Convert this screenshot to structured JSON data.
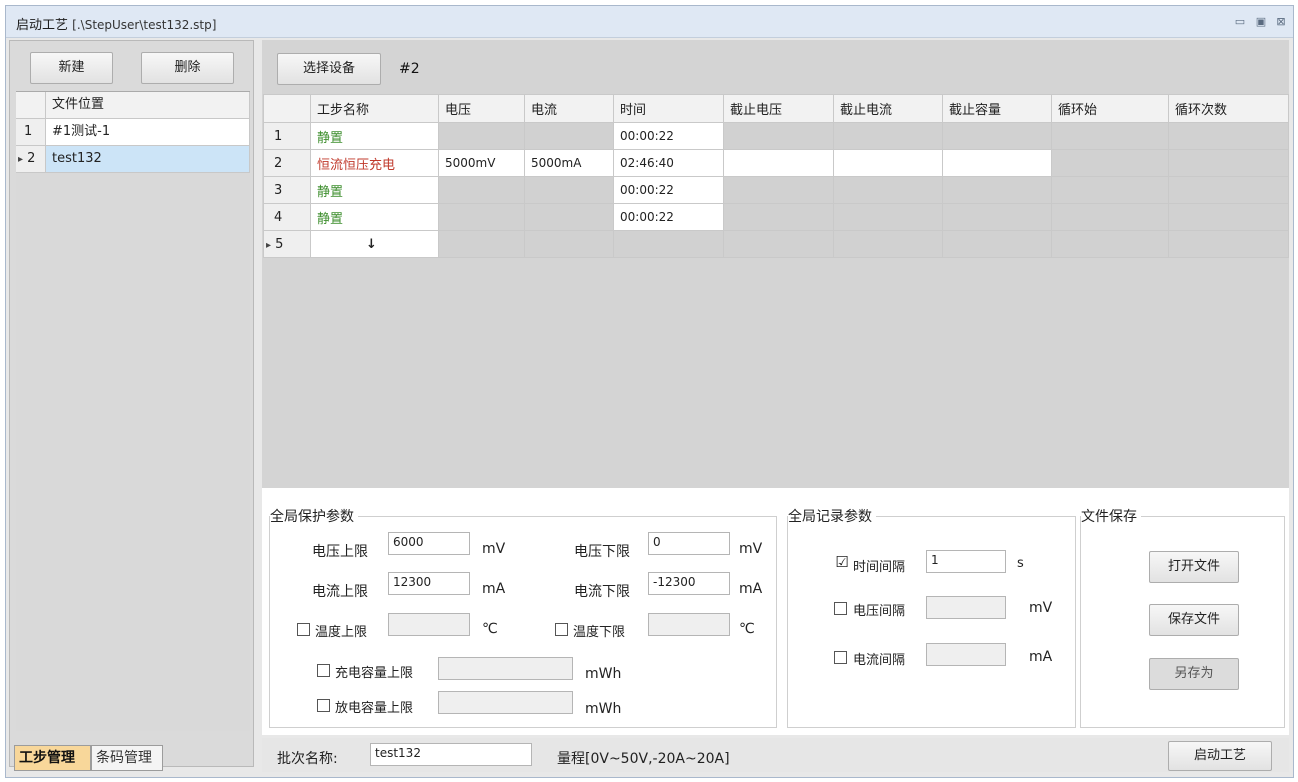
{
  "window": {
    "title": "启动工艺",
    "path": "[.\\StepUser\\test132.stp]",
    "controls": [
      "minimize-icon",
      "maximize-icon",
      "close-icon"
    ]
  },
  "left": {
    "new_label": "新建",
    "delete_label": "删除",
    "column": "文件位置",
    "rows": [
      {
        "index": "1",
        "name": "#1测试-1"
      },
      {
        "index": "2",
        "name": "test132"
      }
    ],
    "selected_marker": "▸"
  },
  "tabs": [
    "工步管理",
    "条码管理"
  ],
  "toolbar": {
    "select_device_label": "选择设备",
    "device_value": "#2"
  },
  "grid": {
    "headers": [
      "工步名称",
      "电压",
      "电流",
      "时间",
      "截止电压",
      "截止电流",
      "截止容量",
      "循环始",
      "循环次数"
    ],
    "rows": [
      {
        "index": "1",
        "name": "静置",
        "voltage": "",
        "current": "",
        "time": "00:00:22"
      },
      {
        "index": "2",
        "name": "恒流恒压充电",
        "voltage": "5000mV",
        "current": "5000mA",
        "time": "02:46:40"
      },
      {
        "index": "3",
        "name": "静置",
        "voltage": "",
        "current": "",
        "time": "00:00:22"
      },
      {
        "index": "4",
        "name": "静置",
        "voltage": "",
        "current": "",
        "time": "00:00:22"
      },
      {
        "index": "5",
        "name": "↓",
        "voltage": "",
        "current": "",
        "time": ""
      }
    ]
  },
  "protect": {
    "title": "全局保护参数",
    "v_upper_label": "电压上限",
    "v_upper_value": "6000",
    "v_upper_unit": "mV",
    "v_lower_label": "电压下限",
    "v_lower_value": "0",
    "v_lower_unit": "mV",
    "i_upper_label": "电流上限",
    "i_upper_value": "12300",
    "i_upper_unit": "mA",
    "i_lower_label": "电流下限",
    "i_lower_value": "-12300",
    "i_lower_unit": "mA",
    "t_upper_label": "温度上限",
    "t_upper_unit": "℃",
    "t_lower_label": "温度下限",
    "t_lower_unit": "℃",
    "charge_cap_label": "充电容量上限",
    "charge_cap_unit": "mWh",
    "discharge_cap_label": "放电容量上限",
    "discharge_cap_unit": "mWh"
  },
  "record": {
    "title": "全局记录参数",
    "time_label": "时间间隔",
    "time_value": "1",
    "time_unit": "s",
    "time_checked": "☑",
    "voltage_label": "电压间隔",
    "voltage_unit": "mV",
    "current_label": "电流间隔",
    "current_unit": "mA"
  },
  "file": {
    "title": "文件保存",
    "open_label": "打开文件",
    "save_label": "保存文件",
    "saveas_label": "另存为"
  },
  "status": {
    "batch_label": "批次名称:",
    "batch_value": "test132",
    "range_text": "量程[0V~50V,-20A~20A]",
    "start_label": "启动工艺"
  }
}
